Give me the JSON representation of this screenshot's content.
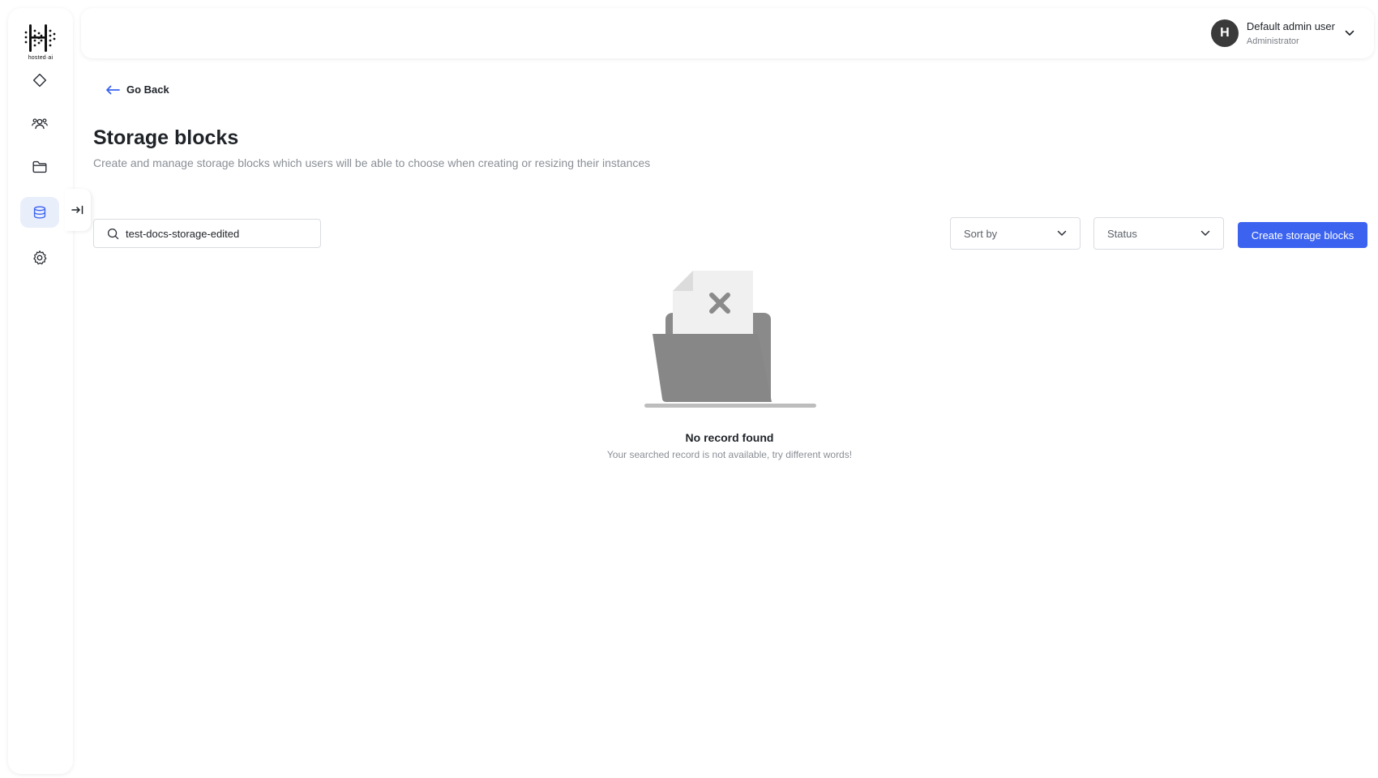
{
  "brand": {
    "logo_text": "hosted·ai"
  },
  "sidebar": {
    "items": [
      {
        "icon": "diamond-icon"
      },
      {
        "icon": "users-icon"
      },
      {
        "icon": "folder-icon"
      },
      {
        "icon": "storage-icon",
        "active": true
      },
      {
        "icon": "gear-icon"
      }
    ]
  },
  "header": {
    "user": {
      "initial": "H",
      "name": "Default admin user",
      "role": "Administrator"
    }
  },
  "nav": {
    "go_back_label": "Go Back"
  },
  "page": {
    "title": "Storage blocks",
    "subtitle": "Create and manage storage blocks which users will be able to choose when creating or resizing their instances"
  },
  "toolbar": {
    "search_value": "test-docs-storage-edited",
    "sort_label": "Sort by",
    "status_label": "Status",
    "create_label": "Create storage blocks"
  },
  "empty_state": {
    "title": "No record found",
    "subtitle": "Your searched record is not available, try different words!"
  },
  "colors": {
    "accent": "#3b63f0",
    "active_nav_bg": "#e9eefb",
    "illustration_gray": "#878787"
  }
}
